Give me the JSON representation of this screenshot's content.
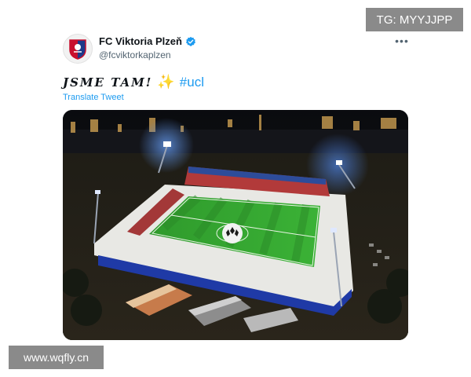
{
  "tweet": {
    "author": {
      "display_name": "FC Viktoria Plzeň",
      "handle": "@fcviktorkaplzen",
      "verified": true
    },
    "text_main": "JSME TAM!",
    "emoji": "sparkles-icon",
    "hashtag": "#ucl",
    "translate_label": "Translate Tweet",
    "more_icon": "more-icon"
  },
  "overlays": {
    "top_right_badge": "TG: MYYJJPP",
    "bottom_left_watermark": "www.wqfly.cn"
  },
  "colors": {
    "link": "#1d9bf0",
    "verified": "#1d9bf0",
    "muted": "#536471",
    "badge_bg": "#8a8a8a"
  }
}
